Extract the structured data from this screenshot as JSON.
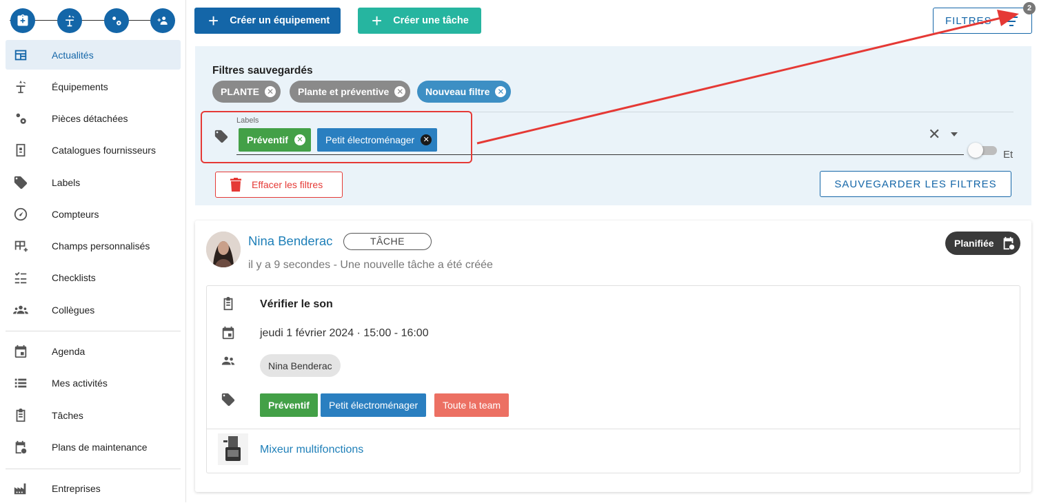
{
  "sidebar": {
    "quick_actions": [
      {
        "icon": "clipboard-plus-icon"
      },
      {
        "icon": "equipment-icon"
      },
      {
        "icon": "gears-icon"
      },
      {
        "icon": "add-colleague-icon"
      }
    ],
    "items": [
      {
        "label": "Actualités",
        "icon": "news-icon",
        "active": true
      },
      {
        "label": "Équipements",
        "icon": "equipment-icon"
      },
      {
        "label": "Pièces détachées",
        "icon": "gears-icon"
      },
      {
        "label": "Catalogues fournisseurs",
        "icon": "catalog-icon"
      },
      {
        "label": "Labels",
        "icon": "tag-icon"
      },
      {
        "label": "Compteurs",
        "icon": "gauge-icon"
      },
      {
        "label": "Champs personnalisés",
        "icon": "table-add-icon"
      },
      {
        "label": "Checklists",
        "icon": "checklist-icon"
      },
      {
        "label": "Collègues",
        "icon": "people-icon"
      },
      {
        "label": "Agenda",
        "icon": "calendar-icon"
      },
      {
        "label": "Mes activités",
        "icon": "list-icon"
      },
      {
        "label": "Tâches",
        "icon": "clipboard-icon"
      },
      {
        "label": "Plans de maintenance",
        "icon": "calendar-clock-icon"
      },
      {
        "label": "Entreprises",
        "icon": "factory-icon"
      }
    ]
  },
  "toolbar": {
    "create_equipment": "Créer un équipement",
    "create_task": "Créer une tâche",
    "filters_label": "FILTRES",
    "filters_badge": "2",
    "primary_color": "#1466a8",
    "teal_color": "#26b5a0"
  },
  "filters": {
    "saved_title": "Filtres sauvegardés",
    "saved_chips": [
      {
        "label": "PLANTE",
        "color": "#8a8a8a"
      },
      {
        "label": "Plante et préventive",
        "color": "#8a8a8a"
      },
      {
        "label": "Nouveau filtre",
        "color": "#3d8fc4"
      }
    ],
    "labels_field_label": "Labels",
    "selected_labels": [
      {
        "label": "Préventif",
        "color": "#43a047"
      },
      {
        "label": "Petit électroménager",
        "color": "#2a7fc0"
      }
    ],
    "toggle_label": "Et",
    "toggle_on": false,
    "clear_label": "Effacer les filtres",
    "save_label": "SAUVEGARDER LES FILTRES"
  },
  "feed": {
    "author": "Nina Benderac",
    "type": "TÂCHE",
    "subtitle": "il y a 9 secondes - Une nouvelle tâche a été créée",
    "status": "Planifiée",
    "task_title": "Vérifier le son",
    "date": "jeudi 1 février 2024 · 15:00 - 16:00",
    "assignee": "Nina Benderac",
    "labels": [
      {
        "label": "Préventif",
        "color": "#43a047"
      },
      {
        "label": "Petit électroménager",
        "color": "#2a7fc0"
      },
      {
        "label": "Toute la team",
        "color": "#ec7063"
      }
    ],
    "equipment": "Mixeur multifonctions"
  }
}
